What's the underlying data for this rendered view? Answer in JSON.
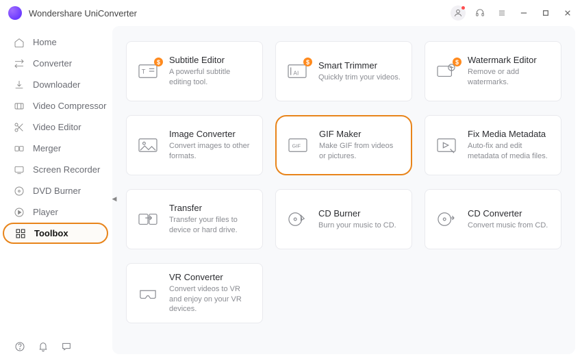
{
  "app": {
    "title": "Wondershare UniConverter"
  },
  "sidebar": {
    "items": [
      {
        "label": "Home"
      },
      {
        "label": "Converter"
      },
      {
        "label": "Downloader"
      },
      {
        "label": "Video Compressor"
      },
      {
        "label": "Video Editor"
      },
      {
        "label": "Merger"
      },
      {
        "label": "Screen Recorder"
      },
      {
        "label": "DVD Burner"
      },
      {
        "label": "Player"
      },
      {
        "label": "Toolbox"
      }
    ]
  },
  "tools": [
    {
      "title": "Subtitle Editor",
      "desc": "A powerful subtitle editing tool.",
      "badge": "$"
    },
    {
      "title": "Smart Trimmer",
      "desc": "Quickly trim your videos.",
      "badge": "$"
    },
    {
      "title": "Watermark Editor",
      "desc": "Remove or add watermarks.",
      "badge": "$"
    },
    {
      "title": "Image Converter",
      "desc": "Convert images to other formats."
    },
    {
      "title": "GIF Maker",
      "desc": "Make GIF from videos or pictures."
    },
    {
      "title": "Fix Media Metadata",
      "desc": "Auto-fix and edit metadata of media files."
    },
    {
      "title": "Transfer",
      "desc": "Transfer your files to device or hard drive."
    },
    {
      "title": "CD Burner",
      "desc": "Burn your music to CD."
    },
    {
      "title": "CD Converter",
      "desc": "Convert music from CD."
    },
    {
      "title": "VR Converter",
      "desc": "Convert videos to VR and enjoy on your VR devices."
    }
  ]
}
